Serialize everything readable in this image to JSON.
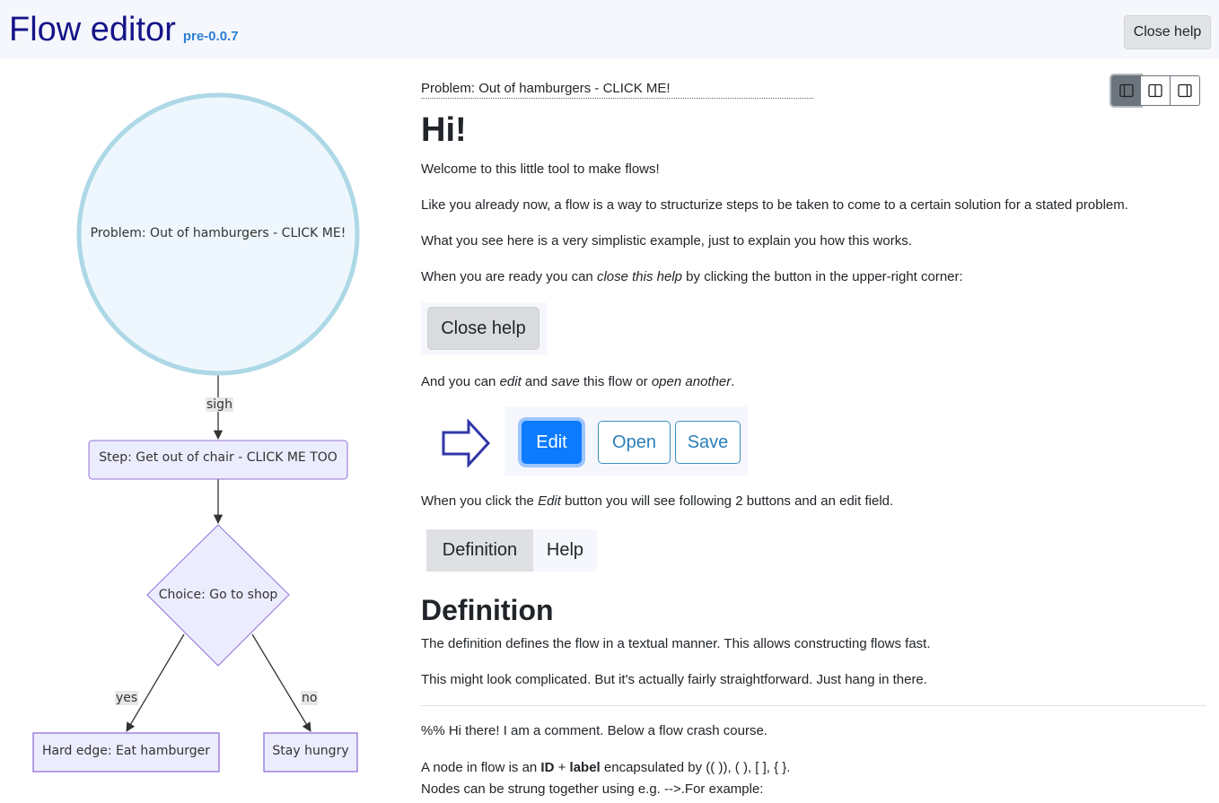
{
  "header": {
    "title": "Flow editor",
    "version": "pre-0.0.7",
    "close_help": "Close help"
  },
  "diagram": {
    "nodes": {
      "problem": "Problem: Out of hamburgers - CLICK ME!",
      "step": "Step: Get out of chair - CLICK ME TOO",
      "choice": "Choice: Go to shop",
      "hard_edge": "Hard edge: Eat hamburger",
      "stay": "Stay hungry"
    },
    "edges": {
      "sigh": "sigh",
      "yes": "yes",
      "no": "no"
    }
  },
  "content": {
    "breadcrumb": "Problem: Out of hamburgers - CLICK ME!",
    "heading": "Hi!",
    "p1": "Welcome to this little tool to make flows!",
    "p2": "Like you already now, a flow is a way to structurize steps to be taken to come to a certain solution for a stated problem.",
    "p3": "What you see here is a very simplistic example, just to explain you how this works.",
    "p4_a": "When you are ready you can ",
    "p4_em": "close this help",
    "p4_b": " by clicking the button in the upper-right corner:",
    "close_help_demo": "Close help",
    "p5_a": "And you can ",
    "p5_em1": "edit",
    "p5_b": " and ",
    "p5_em2": "save",
    "p5_c": " this flow or ",
    "p5_em3": "open another",
    "p5_d": ".",
    "edit": "Edit",
    "open": "Open",
    "save": "Save",
    "p6_a": "When you click the ",
    "p6_em": "Edit",
    "p6_b": " button you will see following 2 buttons and an edit field.",
    "tab_definition": "Definition",
    "tab_help": "Help",
    "definition_heading": "Definition",
    "p7": "The definition defines the flow in a textual manner. This allows constructing flows fast.",
    "p8": "This might look complicated. But it's actually fairly straightforward. Just hang in there.",
    "comment": "%% Hi there! I am a comment. Below a flow crash course.",
    "p9_a": "A node in flow is an ",
    "p9_b1": "ID",
    "p9_plus": " + ",
    "p9_b2": "label",
    "p9_c": " encapsulated by (( )), ( ), [ ], { }.",
    "p10": "Nodes can be strung together using e.g. -->.For example:"
  },
  "colors": {
    "title": "#141488",
    "version": "#2a7fd6",
    "primary": "#0d7bfd",
    "outline": "#2a7fb8",
    "node_fill": "#ececff",
    "node_stroke": "#9370db",
    "circle_fill": "#eef7fd",
    "circle_stroke": "#add8e6",
    "arrow": "#333333",
    "arrow_icon": "#3236a8"
  }
}
